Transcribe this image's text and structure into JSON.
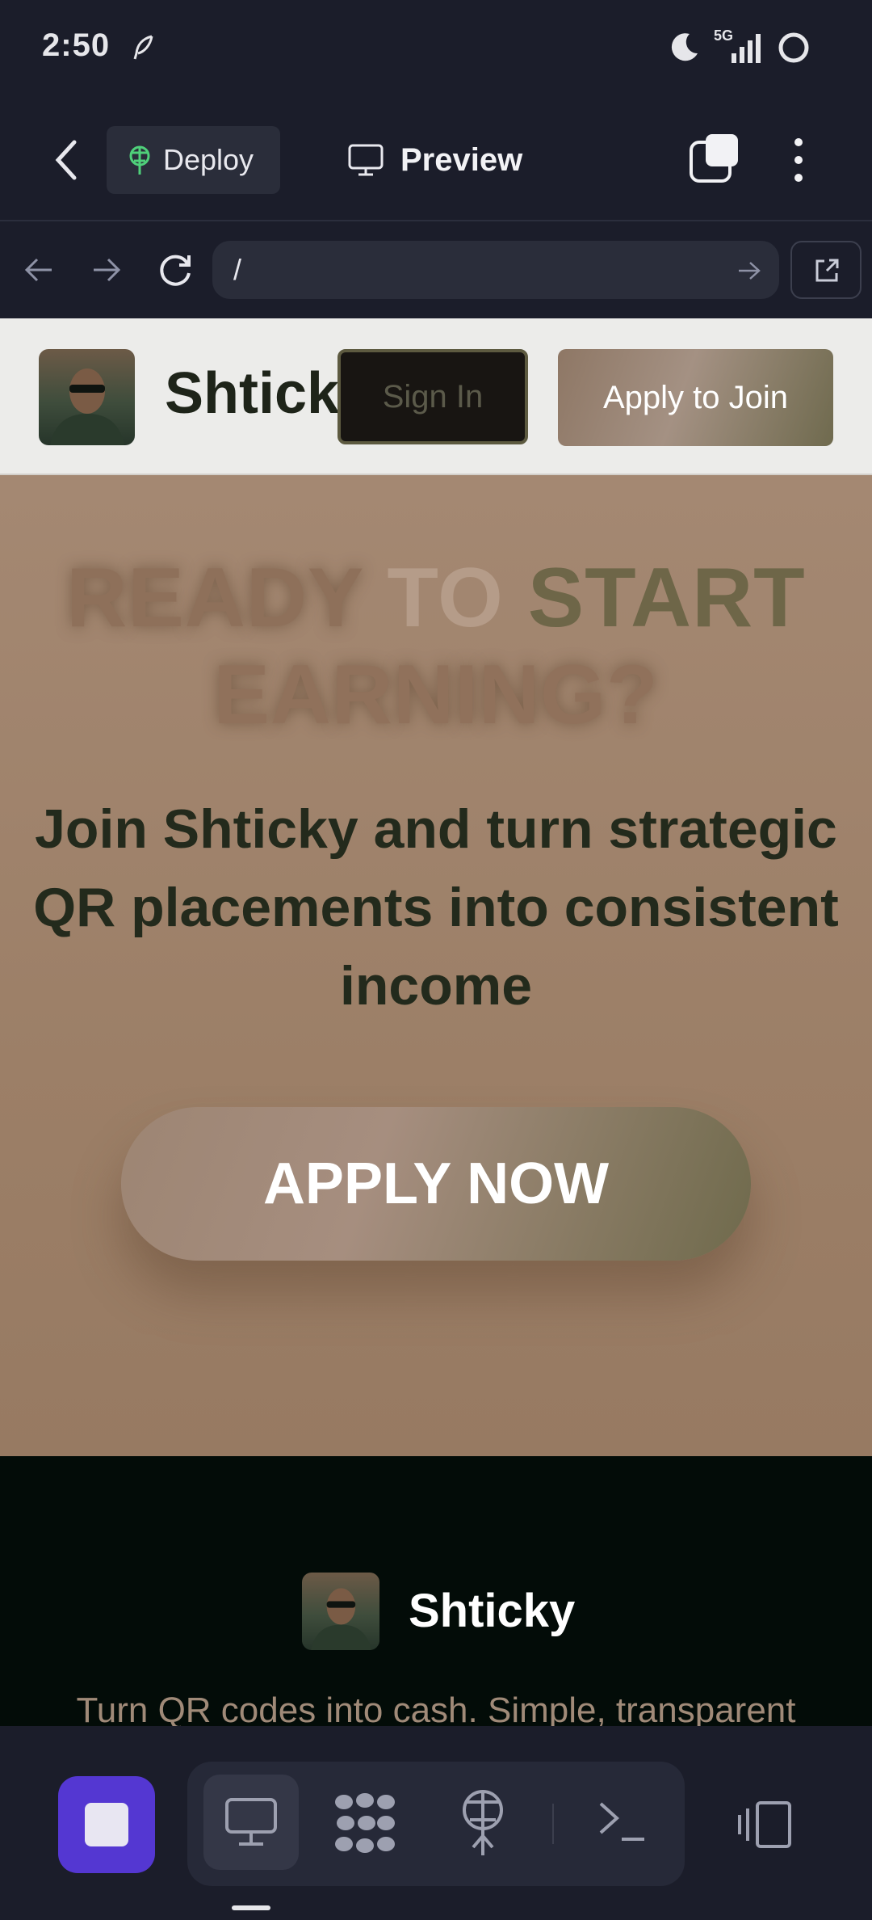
{
  "status_bar": {
    "time": "2:50",
    "network": "5G"
  },
  "app_header": {
    "deploy_label": "Deploy",
    "preview_label": "Preview"
  },
  "browser": {
    "url": "/"
  },
  "site": {
    "brand": "Shticky",
    "sign_in_label": "Sign In",
    "apply_label": "Apply to Join",
    "headline": [
      "READY",
      "TO",
      "START",
      "EARNING?"
    ],
    "subheadline": "Join Shticky and turn strategic QR placements into consistent income",
    "cta_label": "APPLY NOW",
    "footer_brand": "Shticky",
    "footer_tagline": "Turn QR codes into cash. Simple, transparent"
  },
  "colors": {
    "accent": "#5437d2",
    "deploy_icon": "#4fd07a",
    "hero_bg": "#a48872",
    "footer_bg": "#030c08"
  },
  "icons": [
    "back-icon",
    "deploy-icon",
    "monitor-icon",
    "tabs-icon",
    "more-icon",
    "arrow-left-icon",
    "arrow-right-icon",
    "reload-icon",
    "go-icon",
    "external-link-icon",
    "stop-icon",
    "desktop-icon",
    "dots-icon",
    "antenna-icon",
    "terminal-icon",
    "device-switch-icon"
  ]
}
